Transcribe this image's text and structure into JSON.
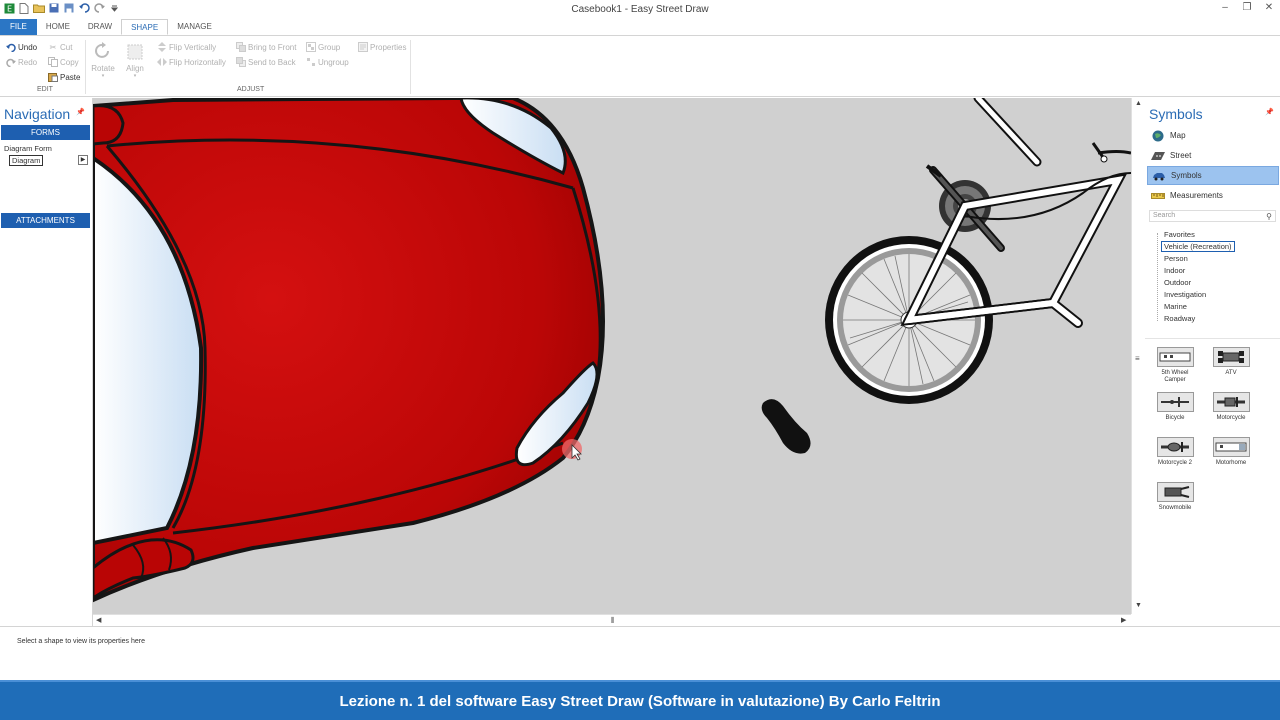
{
  "window": {
    "title": "Casebook1 - Easy Street Draw"
  },
  "ribbon_tabs": [
    {
      "label": "FILE"
    },
    {
      "label": "HOME"
    },
    {
      "label": "DRAW"
    },
    {
      "label": "SHAPE"
    },
    {
      "label": "MANAGE"
    }
  ],
  "ribbon": {
    "edit": {
      "undo": "Undo",
      "redo": "Redo",
      "cut": "Cut",
      "copy": "Copy",
      "paste": "Paste",
      "group_label": "EDIT"
    },
    "adjust": {
      "rotate": "Rotate",
      "align": "Align",
      "flip_vertically": "Flip Vertically",
      "flip_horizontally": "Flip Horizontally",
      "bring_to_front": "Bring to Front",
      "send_to_back": "Send to Back",
      "group": "Group",
      "ungroup": "Ungroup",
      "properties": "Properties",
      "group_label": "ADJUST"
    }
  },
  "navigation": {
    "title": "Navigation",
    "forms_label": "FORMS",
    "form_name": "Diagram Form",
    "selected_item": "Diagram",
    "attachments_label": "ATTACHMENTS"
  },
  "symbols": {
    "title": "Symbols",
    "categories": [
      {
        "label": "Map",
        "icon": "map-globe-icon"
      },
      {
        "label": "Street",
        "icon": "street-icon"
      },
      {
        "label": "Symbols",
        "icon": "car-icon"
      },
      {
        "label": "Measurements",
        "icon": "ruler-icon"
      }
    ],
    "search_placeholder": "Search",
    "tree": [
      "Favorites",
      "Vehicle (Recreation)",
      "Person",
      "Indoor",
      "Outdoor",
      "Investigation",
      "Marine",
      "Roadway"
    ],
    "tiles": [
      {
        "label": "5th Wheel Camper"
      },
      {
        "label": "ATV"
      },
      {
        "label": "Bicycle"
      },
      {
        "label": "Motorcycle"
      },
      {
        "label": "Motorcycle 2"
      },
      {
        "label": "Motorhome"
      },
      {
        "label": "Snowmobile"
      }
    ]
  },
  "properties": {
    "hint": "Select a shape to view its properties here"
  },
  "caption": "Lezione n. 1 del software Easy Street Draw (Software in valutazione) By Carlo Feltrin",
  "colors": {
    "accent": "#2b76c5",
    "car_red": "#c40808",
    "canvas": "#d0d0d0",
    "caption_bg": "#1f6db8"
  }
}
